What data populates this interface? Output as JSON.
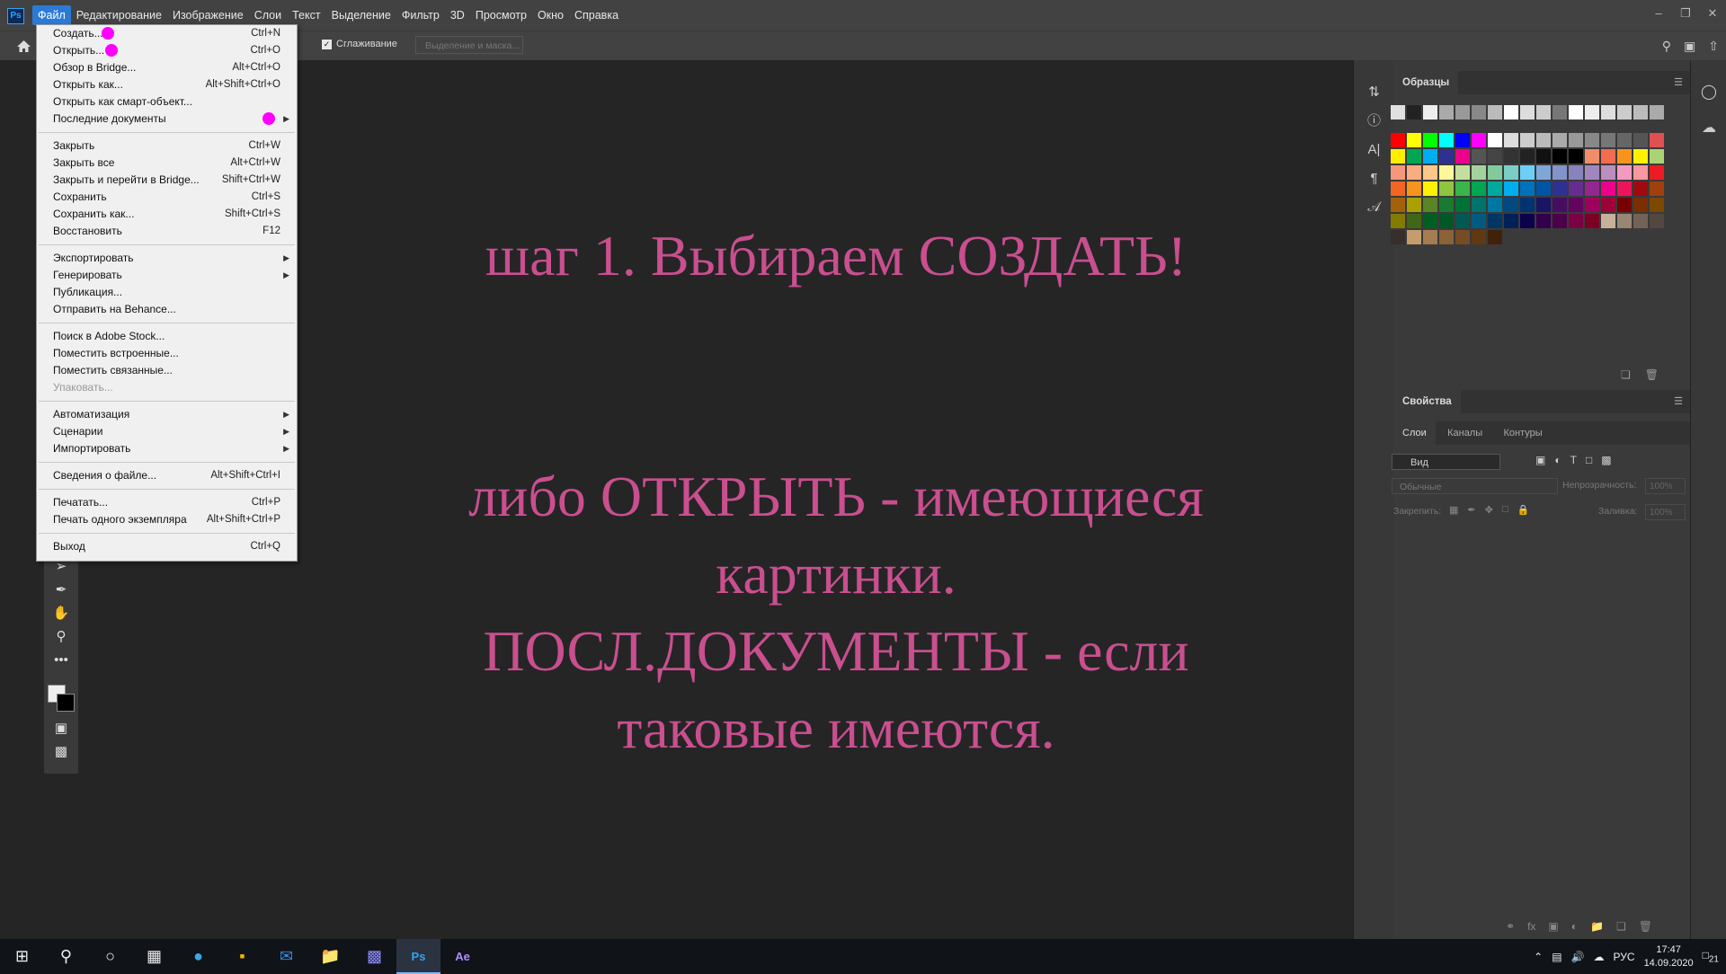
{
  "app": {
    "logo": "Ps"
  },
  "menubar": {
    "items": [
      "Файл",
      "Редактирование",
      "Изображение",
      "Слои",
      "Текст",
      "Выделение",
      "Фильтр",
      "3D",
      "Просмотр",
      "Окно",
      "Справка"
    ]
  },
  "window_controls": [
    "minimize-icon",
    "restore-icon",
    "close-icon"
  ],
  "options_bar": {
    "smoothing_label": "Сглаживание",
    "smoothing_checked": true,
    "mask_button": "Выделение и маска..."
  },
  "file_menu": {
    "groups": [
      [
        {
          "label": "Создать...",
          "shortcut": "Ctrl+N"
        },
        {
          "label": "Открыть...",
          "shortcut": "Ctrl+O"
        },
        {
          "label": "Обзор в Bridge...",
          "shortcut": "Alt+Ctrl+O"
        },
        {
          "label": "Открыть как...",
          "shortcut": "Alt+Shift+Ctrl+O"
        },
        {
          "label": "Открыть как смарт-объект...",
          "shortcut": ""
        },
        {
          "label": "Последние документы",
          "shortcut": "",
          "submenu": true
        }
      ],
      [
        {
          "label": "Закрыть",
          "shortcut": "Ctrl+W"
        },
        {
          "label": "Закрыть все",
          "shortcut": "Alt+Ctrl+W"
        },
        {
          "label": "Закрыть и перейти в Bridge...",
          "shortcut": "Shift+Ctrl+W"
        },
        {
          "label": "Сохранить",
          "shortcut": "Ctrl+S"
        },
        {
          "label": "Сохранить как...",
          "shortcut": "Shift+Ctrl+S"
        },
        {
          "label": "Восстановить",
          "shortcut": "F12"
        }
      ],
      [
        {
          "label": "Экспортировать",
          "shortcut": "",
          "submenu": true
        },
        {
          "label": "Генерировать",
          "shortcut": "",
          "submenu": true
        },
        {
          "label": "Публикация...",
          "shortcut": ""
        },
        {
          "label": "Отправить на Behance...",
          "shortcut": ""
        }
      ],
      [
        {
          "label": "Поиск в Adobe Stock...",
          "shortcut": ""
        },
        {
          "label": "Поместить встроенные...",
          "shortcut": ""
        },
        {
          "label": "Поместить связанные...",
          "shortcut": ""
        },
        {
          "label": "Упаковать...",
          "shortcut": "",
          "disabled": true
        }
      ],
      [
        {
          "label": "Автоматизация",
          "shortcut": "",
          "submenu": true
        },
        {
          "label": "Сценарии",
          "shortcut": "",
          "submenu": true
        },
        {
          "label": "Импортировать",
          "shortcut": "",
          "submenu": true
        }
      ],
      [
        {
          "label": "Сведения о файле...",
          "shortcut": "Alt+Shift+Ctrl+I"
        }
      ],
      [
        {
          "label": "Печатать...",
          "shortcut": "Ctrl+P"
        },
        {
          "label": "Печать одного экземпляра",
          "shortcut": "Alt+Shift+Ctrl+P"
        }
      ],
      [
        {
          "label": "Выход",
          "shortcut": "Ctrl+Q"
        }
      ]
    ],
    "highlight_color": "#ff00ff"
  },
  "canvas": {
    "line1": "шаг 1. Выбираем СОЗДАТЬ!",
    "line2": "либо ОТКРЫТЬ - имеющиеся",
    "line3": "картинки.",
    "line4": "ПОСЛ.ДОКУМЕНТЫ - если",
    "line5": "таковые имеются.",
    "text_color": "#c94f8f"
  },
  "panels": {
    "swatches_title": "Образцы",
    "properties_title": "Свойства",
    "layers_tabs": [
      "Слои",
      "Каналы",
      "Контуры"
    ],
    "filter_value": "Вид",
    "blend_mode": "Обычные",
    "opacity_label": "Непрозрачность:",
    "opacity_value": "100%",
    "lock_label": "Закрепить:",
    "fill_label": "Заливка:",
    "fill_value": "100%"
  },
  "taskbar": {
    "language": "РУС",
    "time": "17:47",
    "date": "14.09.2020",
    "notifications": "21"
  }
}
